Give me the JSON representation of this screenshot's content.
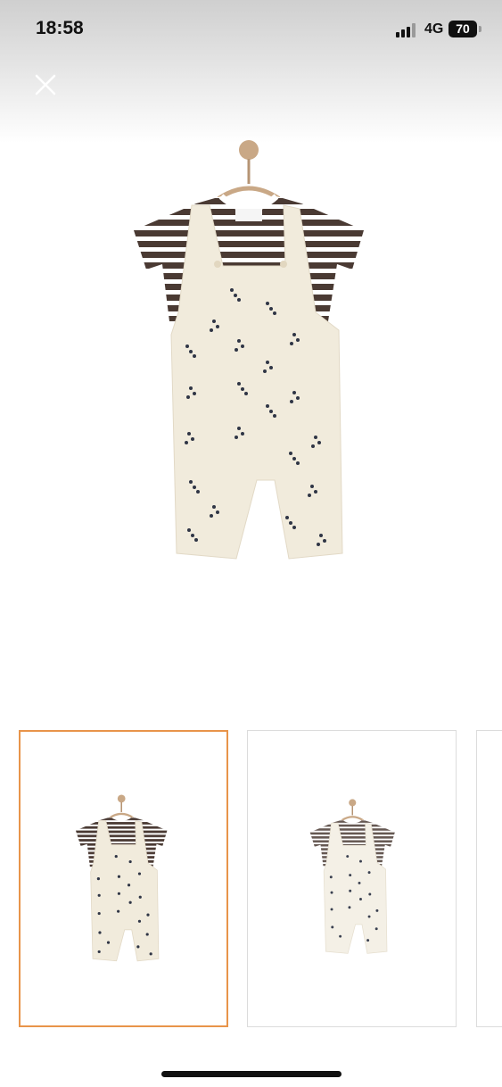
{
  "status_bar": {
    "time": "18:58",
    "network": "4G",
    "battery": "70"
  },
  "toolbar": {
    "close_icon": "close-icon"
  },
  "gallery": {
    "selected_index": 0,
    "thumbnail_count_visible": 3
  },
  "colors": {
    "accent_selected_border": "#e8944a",
    "stripe_brown": "#4a3a33",
    "overall_cream": "#f1ebdc"
  }
}
